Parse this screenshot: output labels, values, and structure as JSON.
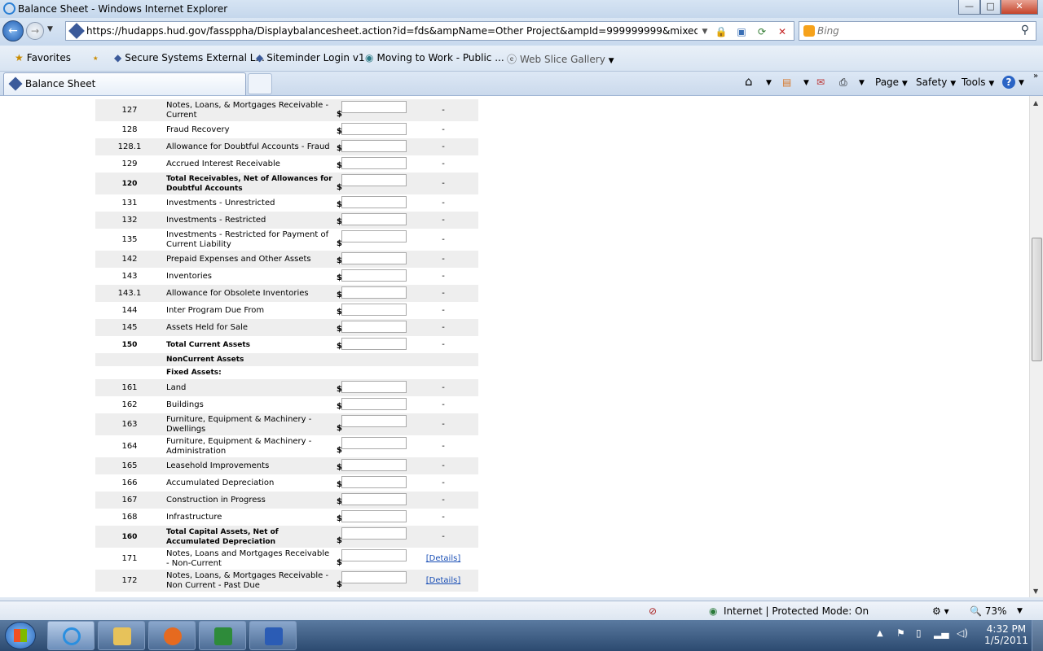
{
  "window": {
    "title": "Balance Sheet - Windows Internet Explorer",
    "minimize": "—",
    "maximize": "□",
    "close": "✕"
  },
  "address": {
    "url": "https://hudapps.hud.gov/fassppha/Displaybalancesheet.action?id=fds&ampName=Other Project&ampId=999999999&mixedFinance=null&pa",
    "search_placeholder": "Bing"
  },
  "favorites": {
    "label": "Favorites",
    "items": [
      "Secure Systems External L...",
      "Siteminder Login v1",
      "Moving to Work - Public ...",
      "Web Slice Gallery"
    ]
  },
  "tab": {
    "label": "Balance Sheet"
  },
  "commandbar": {
    "page": "Page",
    "safety": "Safety",
    "tools": "Tools",
    "help": "?"
  },
  "rows": [
    {
      "num": "127",
      "desc": "Notes, Loans, & Mortgages Receivable - Current",
      "bold": false,
      "input": true,
      "value": "-",
      "tall": true
    },
    {
      "num": "128",
      "desc": "Fraud Recovery",
      "bold": false,
      "input": true,
      "value": "-"
    },
    {
      "num": "128.1",
      "desc": "Allowance for Doubtful Accounts - Fraud",
      "bold": false,
      "input": true,
      "value": "-"
    },
    {
      "num": "129",
      "desc": "Accrued Interest Receivable",
      "bold": false,
      "input": true,
      "value": "-"
    },
    {
      "num": "120",
      "desc": "Total Receivables, Net of Allowances for Doubtful Accounts",
      "bold": true,
      "input": true,
      "value": "-",
      "tall": true
    },
    {
      "num": "131",
      "desc": "Investments - Unrestricted",
      "bold": false,
      "input": true,
      "value": "-"
    },
    {
      "num": "132",
      "desc": "Investments - Restricted",
      "bold": false,
      "input": true,
      "value": "-"
    },
    {
      "num": "135",
      "desc": "Investments - Restricted for Payment of Current Liability",
      "bold": false,
      "input": true,
      "value": "-",
      "tall": true
    },
    {
      "num": "142",
      "desc": "Prepaid Expenses and Other Assets",
      "bold": false,
      "input": true,
      "value": "-"
    },
    {
      "num": "143",
      "desc": "Inventories",
      "bold": false,
      "input": true,
      "value": "-"
    },
    {
      "num": "143.1",
      "desc": "Allowance for Obsolete Inventories",
      "bold": false,
      "input": true,
      "value": "-"
    },
    {
      "num": "144",
      "desc": "Inter Program Due From",
      "bold": false,
      "input": true,
      "value": "-"
    },
    {
      "num": "145",
      "desc": "Assets Held for Sale",
      "bold": false,
      "input": true,
      "value": "-"
    },
    {
      "num": "150",
      "desc": "Total Current Assets",
      "bold": true,
      "input": true,
      "value": "-"
    },
    {
      "num": "",
      "desc": "NonCurrent Assets",
      "bold": true,
      "input": false,
      "value": "",
      "short": true
    },
    {
      "num": "",
      "desc": "Fixed Assets:",
      "bold": true,
      "input": false,
      "value": "",
      "short": true
    },
    {
      "num": "161",
      "desc": "Land",
      "bold": false,
      "input": true,
      "value": "-"
    },
    {
      "num": "162",
      "desc": "Buildings",
      "bold": false,
      "input": true,
      "value": "-"
    },
    {
      "num": "163",
      "desc": "Furniture, Equipment & Machinery - Dwellings",
      "bold": false,
      "input": true,
      "value": "-",
      "tall": true
    },
    {
      "num": "164",
      "desc": "Furniture, Equipment & Machinery - Administration",
      "bold": false,
      "input": true,
      "value": "-",
      "tall": true
    },
    {
      "num": "165",
      "desc": "Leasehold Improvements",
      "bold": false,
      "input": true,
      "value": "-"
    },
    {
      "num": "166",
      "desc": "Accumulated Depreciation",
      "bold": false,
      "input": true,
      "value": "-"
    },
    {
      "num": "167",
      "desc": "Construction in Progress",
      "bold": false,
      "input": true,
      "value": "-"
    },
    {
      "num": "168",
      "desc": "Infrastructure",
      "bold": false,
      "input": true,
      "value": "-"
    },
    {
      "num": "160",
      "desc": "Total Capital Assets, Net of Accumulated Depreciation",
      "bold": true,
      "input": true,
      "value": "-",
      "tall": true
    },
    {
      "num": "171",
      "desc": "Notes, Loans and Mortgages Receivable - Non-Current",
      "bold": false,
      "input": true,
      "value": "[Details]",
      "link": true,
      "tall": true
    },
    {
      "num": "172",
      "desc": "Notes, Loans, & Mortgages Receivable - Non Current - Past Due",
      "bold": false,
      "input": true,
      "value": "[Details]",
      "link": true,
      "tall": true
    }
  ],
  "status": {
    "zone": "Internet | Protected Mode: On",
    "zoom": "73%"
  },
  "taskbar": {
    "time": "4:32 PM",
    "date": "1/5/2011"
  }
}
